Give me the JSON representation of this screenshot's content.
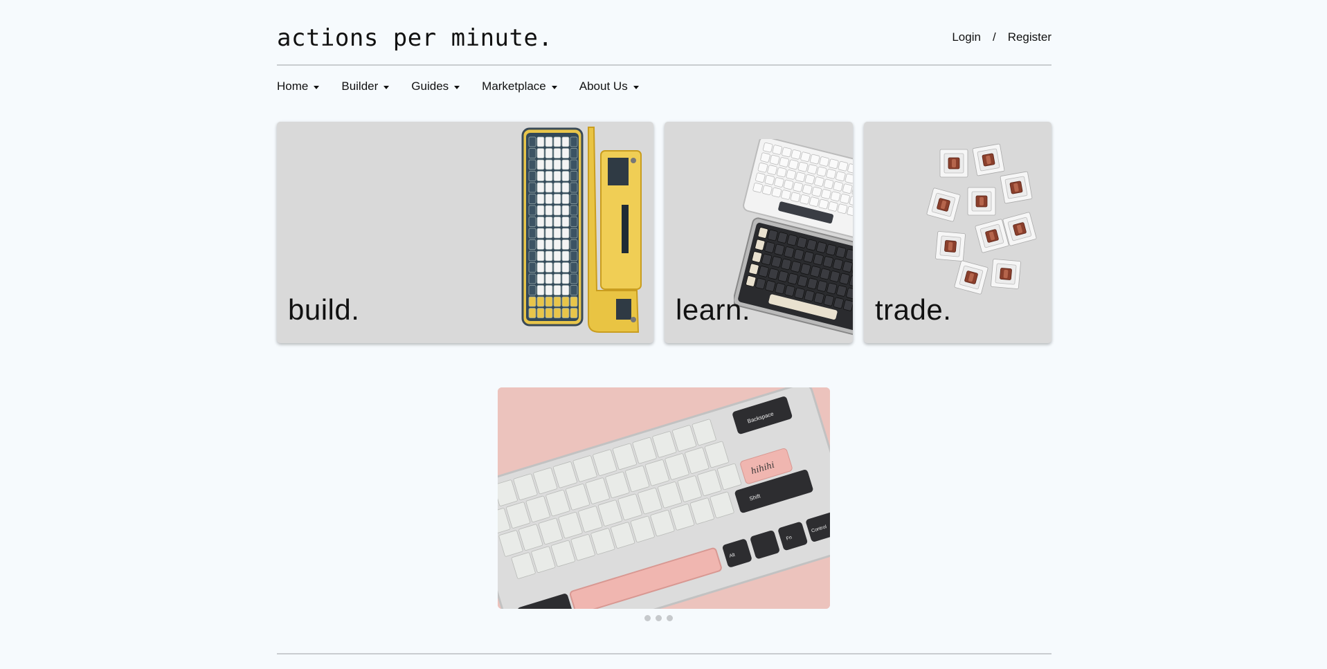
{
  "brand": {
    "title": "actions per minute."
  },
  "auth": {
    "login": "Login",
    "separator": "/",
    "register": "Register"
  },
  "nav": {
    "items": [
      {
        "label": "Home"
      },
      {
        "label": "Builder"
      },
      {
        "label": "Guides"
      },
      {
        "label": "Marketplace"
      },
      {
        "label": "About Us"
      }
    ]
  },
  "cards": [
    {
      "label": "build.",
      "image": "keyboard-yellow-image"
    },
    {
      "label": "learn.",
      "image": "keyboards-stacked-image"
    },
    {
      "label": "trade.",
      "image": "switches-image"
    }
  ],
  "carousel": {
    "image": "pink-keyboard-image",
    "slides": 3,
    "key_labels": {
      "backspace": "Backspace",
      "custom": "hihihi",
      "shift": "Shift",
      "fn": "Fn",
      "control": "Control",
      "alt": "Alt"
    }
  },
  "colors": {
    "background": "#f6fafd",
    "card": "#d9d9d9",
    "accent_pink": "#ecc3bd"
  }
}
